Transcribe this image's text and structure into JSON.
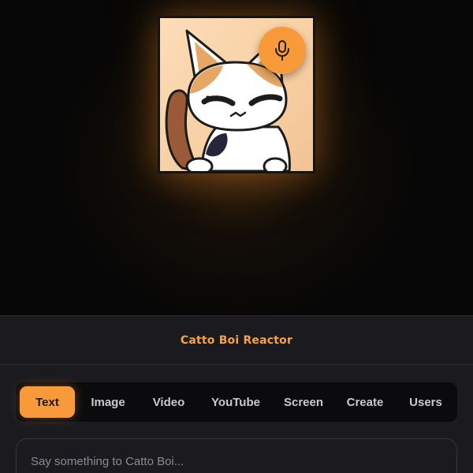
{
  "app": {
    "title": "Catto Boi Reactor"
  },
  "avatar": {
    "name": "Catto Boi"
  },
  "mic": {
    "icon": "microphone-icon",
    "color": "#f89a3a"
  },
  "tabs": [
    {
      "label": "Text",
      "active": true
    },
    {
      "label": "Image",
      "active": false
    },
    {
      "label": "Video",
      "active": false
    },
    {
      "label": "YouTube",
      "active": false
    },
    {
      "label": "Screen",
      "active": false
    },
    {
      "label": "Create",
      "active": false
    },
    {
      "label": "Users",
      "active": false
    }
  ],
  "chat": {
    "placeholder": "Say something to Catto Boi..."
  },
  "colors": {
    "accent": "#f89a3a",
    "title": "#f7a14a",
    "panel": "#1b1b1f",
    "tabbar": "#0b0b0d"
  }
}
